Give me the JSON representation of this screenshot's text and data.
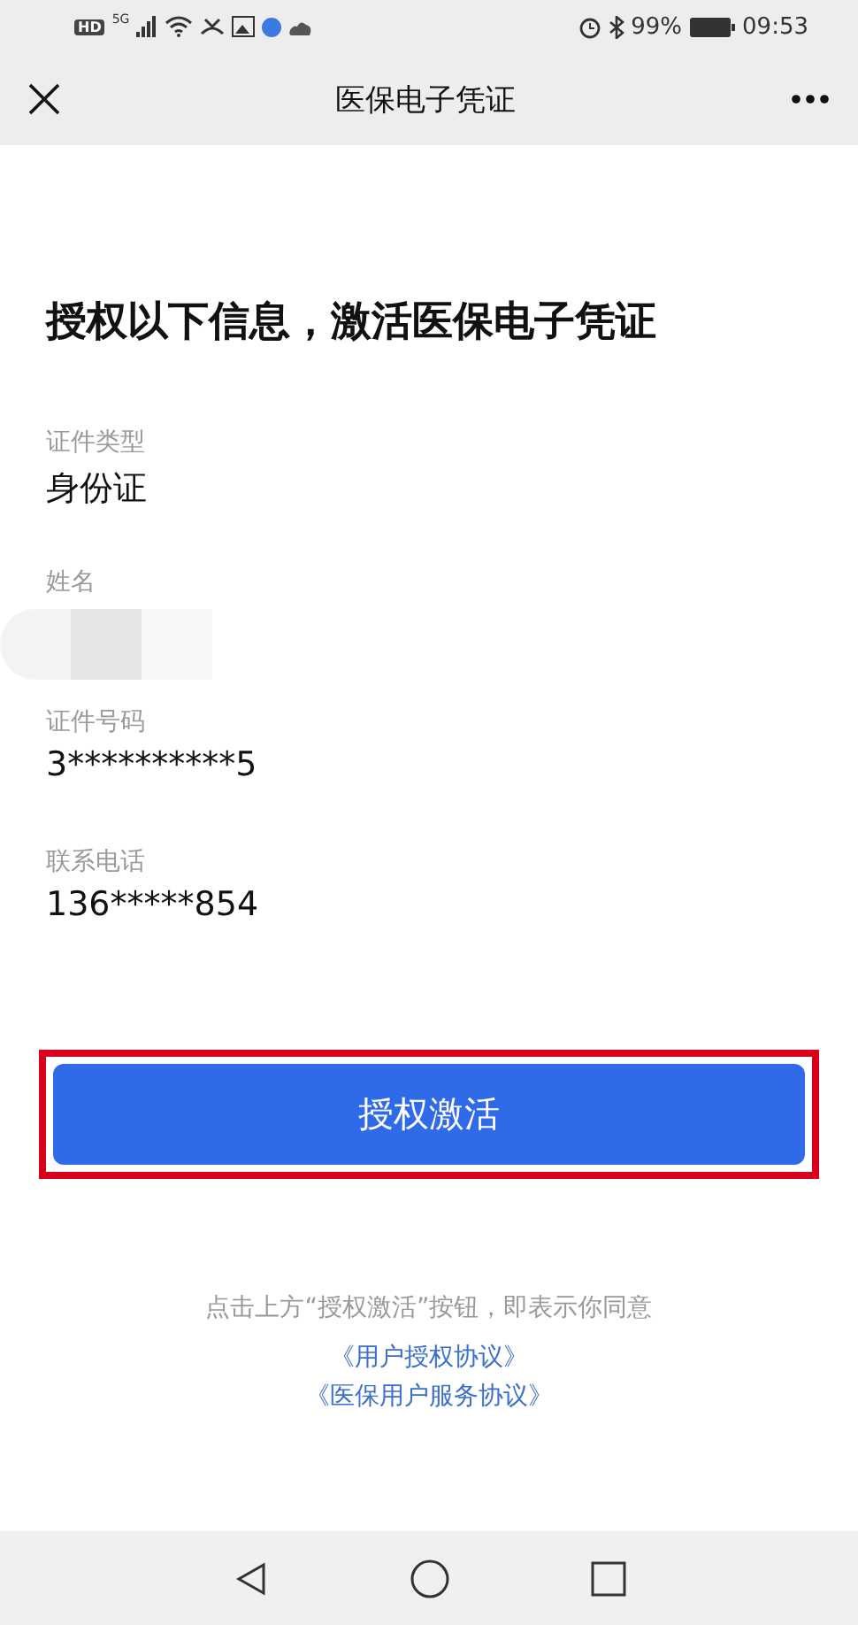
{
  "status_bar": {
    "left_badges": [
      "HD",
      "5G"
    ],
    "battery": "99%",
    "time": "09:53"
  },
  "nav_bar": {
    "title": "医保电子凭证"
  },
  "heading": "授权以下信息，激活医保电子凭证",
  "fields": [
    {
      "label": "证件类型",
      "kind": "text",
      "value": "身份证"
    },
    {
      "label": "姓名",
      "kind": "redacted"
    },
    {
      "label": "证件号码",
      "kind": "text",
      "value": "3**********5"
    },
    {
      "label": "联系电话",
      "kind": "text",
      "value": "136*****854"
    }
  ],
  "button": {
    "label": "授权激活",
    "highlighted": true
  },
  "notice": "点击上方“授权激活”按钮，即表示你同意",
  "links": [
    "《用户授权协议》",
    "《医保用户服务协议》"
  ]
}
